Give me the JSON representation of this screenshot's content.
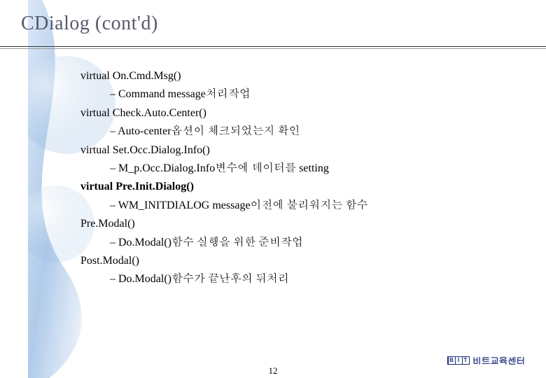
{
  "title": "CDialog (cont'd)",
  "page_number": "12",
  "brand": {
    "logo_letters": [
      "B",
      "I",
      "T"
    ],
    "text": "비트교육센터"
  },
  "items": [
    {
      "head": "virtual On.Cmd.Msg()",
      "desc": "– Command message처리작업",
      "bold": false
    },
    {
      "head": "virtual Check.Auto.Center()",
      "desc": "– Auto-center옵션이 체크되었는지 확인",
      "bold": false
    },
    {
      "head": "virtual Set.Occ.Dialog.Info()",
      "desc": "– M_p.Occ.Dialog.Info변수에 데이터를 setting",
      "bold": false
    },
    {
      "head": "virtual Pre.Init.Dialog()",
      "desc": "– WM_INITDIALOG message이전에 불리워지는 함수",
      "bold": true
    },
    {
      "head": "Pre.Modal()",
      "desc": "– Do.Modal()함수 실행을 위한 준비작업",
      "bold": false
    },
    {
      "head": "Post.Modal()",
      "desc": "– Do.Modal()함수가 끝난후의 뒤처리",
      "bold": false
    }
  ]
}
